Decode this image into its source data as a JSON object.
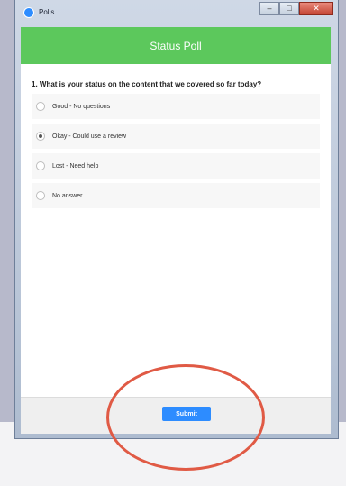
{
  "window": {
    "title": "Polls",
    "minimize": "–",
    "maximize": "□",
    "close": "✕"
  },
  "poll": {
    "header": "Status Poll",
    "question": "1. What is your status on the content that we covered so far today?",
    "options": [
      {
        "label": "Good - No questions",
        "selected": false
      },
      {
        "label": "Okay - Could use a review",
        "selected": true
      },
      {
        "label": "Lost - Need help",
        "selected": false
      },
      {
        "label": "No answer",
        "selected": false
      }
    ]
  },
  "footer": {
    "submit_label": "Submit"
  },
  "colors": {
    "header_green": "#5cc85c",
    "submit_blue": "#2d8cff",
    "annotation_red": "#e05a45"
  }
}
